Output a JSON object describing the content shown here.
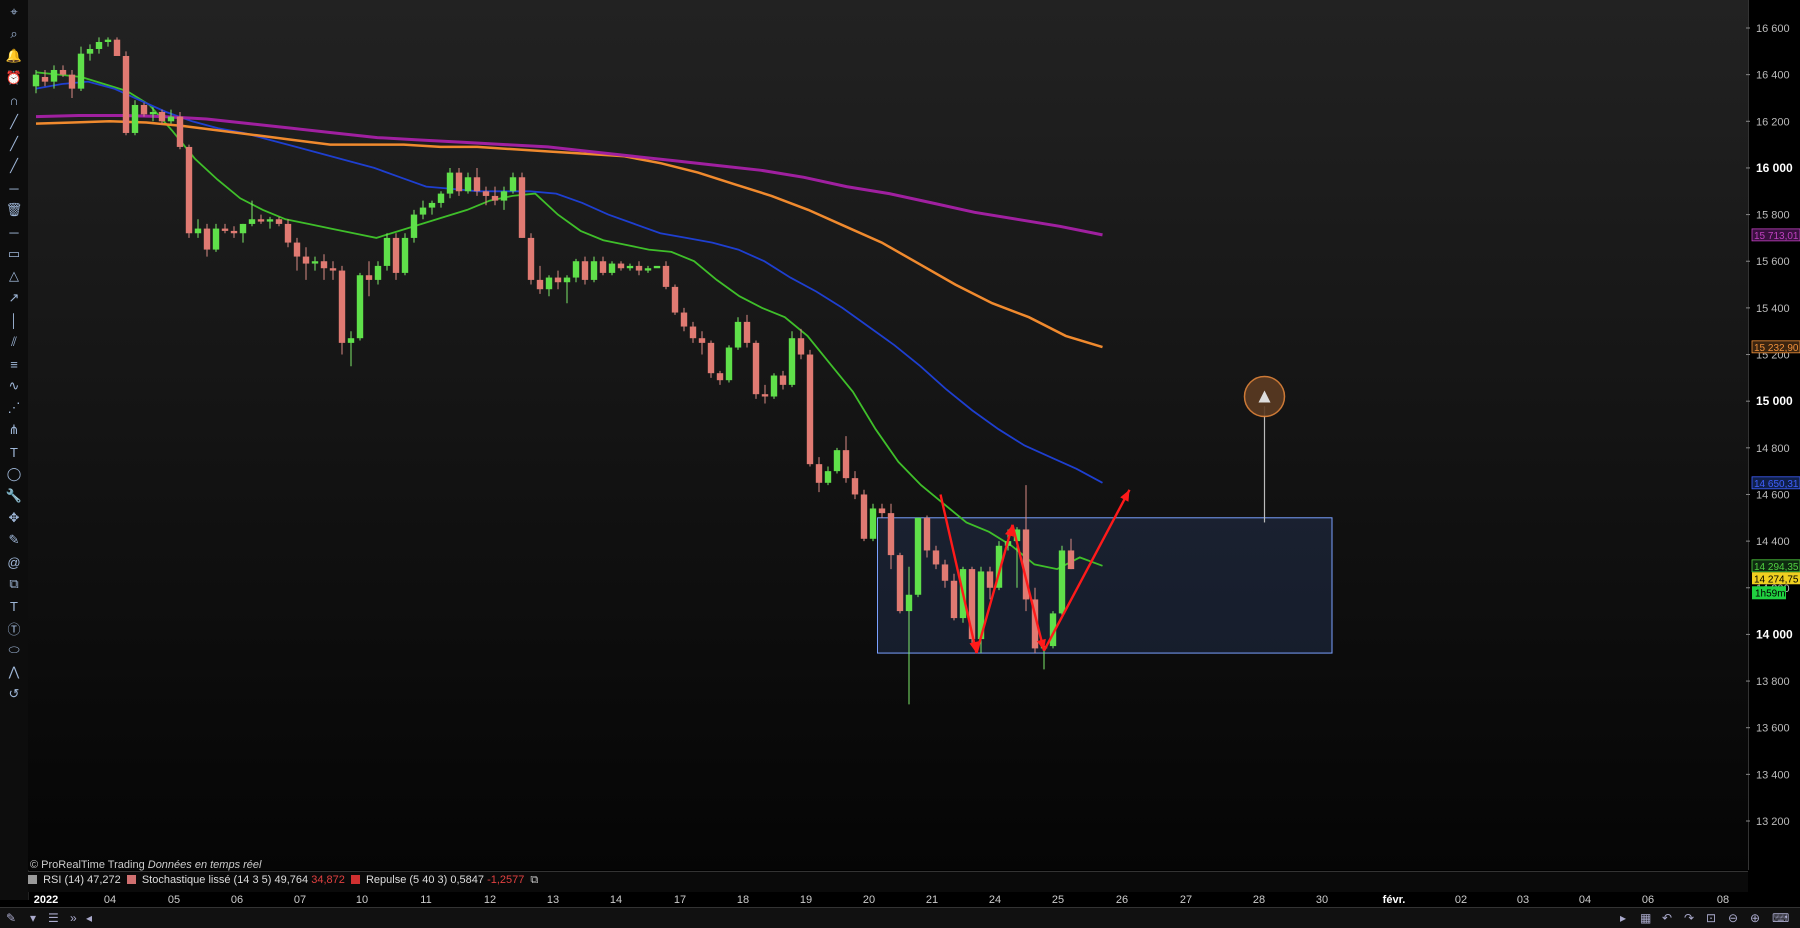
{
  "copyright": {
    "brand": "© ProRealTime Trading",
    "realtime": "Données en temps réel"
  },
  "indicators": [
    {
      "name": "RSI (14)",
      "value": "47,272",
      "color": "#9a9a9a"
    },
    {
      "name": "Stochastique lissé (14 3 5)",
      "value": "49,764",
      "value2": "34,872",
      "color": "#d07070"
    },
    {
      "name": "Repulse (5 40 3)",
      "value": "0,5847",
      "value2": "-1,2577",
      "color": "#d03030"
    }
  ],
  "price_tags": {
    "ma_purple": "15 713,01",
    "ma_orange": "15 232,90",
    "ma_blue": "14 650,31",
    "ma_green": "14 294,35",
    "last": "14 274,75",
    "countdown": "1h59m"
  },
  "chart_data": {
    "type": "candlestick",
    "ylim": [
      13000,
      16700
    ],
    "y_ticks": [
      "16 600",
      "16 400",
      "16 200",
      "16 000",
      "15 800",
      "15 600",
      "15 400",
      "15 200",
      "15 000",
      "14 800",
      "14 600",
      "14 400",
      "14 200",
      "14 000",
      "13 800",
      "13 600",
      "13 400",
      "13 200"
    ],
    "x_labels": [
      "2022",
      "04",
      "05",
      "06",
      "07",
      "10",
      "11",
      "12",
      "13",
      "14",
      "17",
      "18",
      "19",
      "20",
      "21",
      "24",
      "25",
      "26",
      "27",
      "28",
      "30",
      "févr.",
      "02",
      "03",
      "04",
      "06",
      "08"
    ],
    "candles": [
      [
        16350,
        16420,
        16320,
        16400
      ],
      [
        16390,
        16420,
        16350,
        16370
      ],
      [
        16370,
        16440,
        16340,
        16420
      ],
      [
        16420,
        16440,
        16390,
        16400
      ],
      [
        16400,
        16420,
        16300,
        16340
      ],
      [
        16340,
        16520,
        16330,
        16490
      ],
      [
        16490,
        16530,
        16460,
        16510
      ],
      [
        16510,
        16560,
        16490,
        16540
      ],
      [
        16540,
        16560,
        16520,
        16550
      ],
      [
        16550,
        16560,
        16490,
        16480
      ],
      [
        16480,
        16500,
        16140,
        16150
      ],
      [
        16150,
        16290,
        16140,
        16270
      ],
      [
        16270,
        16280,
        16220,
        16230
      ],
      [
        16230,
        16260,
        16200,
        16240
      ],
      [
        16240,
        16250,
        16190,
        16200
      ],
      [
        16200,
        16250,
        16190,
        16220
      ],
      [
        16220,
        16240,
        16080,
        16090
      ],
      [
        16090,
        16100,
        15700,
        15720
      ],
      [
        15720,
        15780,
        15700,
        15740
      ],
      [
        15740,
        15760,
        15620,
        15650
      ],
      [
        15650,
        15760,
        15640,
        15740
      ],
      [
        15740,
        15760,
        15720,
        15730
      ],
      [
        15730,
        15750,
        15700,
        15720
      ],
      [
        15720,
        15760,
        15680,
        15760
      ],
      [
        15760,
        15860,
        15750,
        15780
      ],
      [
        15780,
        15800,
        15760,
        15770
      ],
      [
        15770,
        15790,
        15740,
        15780
      ],
      [
        15780,
        15790,
        15750,
        15760
      ],
      [
        15760,
        15780,
        15660,
        15680
      ],
      [
        15680,
        15700,
        15560,
        15620
      ],
      [
        15620,
        15660,
        15520,
        15590
      ],
      [
        15590,
        15620,
        15560,
        15600
      ],
      [
        15600,
        15630,
        15520,
        15570
      ],
      [
        15570,
        15600,
        15520,
        15560
      ],
      [
        15560,
        15580,
        15200,
        15250
      ],
      [
        15250,
        15300,
        15150,
        15270
      ],
      [
        15270,
        15550,
        15260,
        15540
      ],
      [
        15540,
        15600,
        15450,
        15520
      ],
      [
        15520,
        15600,
        15500,
        15580
      ],
      [
        15580,
        15720,
        15560,
        15700
      ],
      [
        15700,
        15720,
        15520,
        15550
      ],
      [
        15550,
        15720,
        15540,
        15700
      ],
      [
        15700,
        15820,
        15680,
        15800
      ],
      [
        15800,
        15860,
        15780,
        15830
      ],
      [
        15830,
        15860,
        15800,
        15850
      ],
      [
        15850,
        15900,
        15830,
        15890
      ],
      [
        15890,
        16000,
        15870,
        15980
      ],
      [
        15980,
        16000,
        15880,
        15900
      ],
      [
        15900,
        15980,
        15890,
        15960
      ],
      [
        15960,
        16000,
        15880,
        15900
      ],
      [
        15900,
        15920,
        15840,
        15880
      ],
      [
        15880,
        15920,
        15840,
        15860
      ],
      [
        15860,
        15920,
        15820,
        15900
      ],
      [
        15900,
        15980,
        15890,
        15960
      ],
      [
        15960,
        15980,
        15700,
        15700
      ],
      [
        15700,
        15720,
        15500,
        15520
      ],
      [
        15520,
        15580,
        15460,
        15480
      ],
      [
        15480,
        15540,
        15450,
        15530
      ],
      [
        15530,
        15560,
        15480,
        15510
      ],
      [
        15510,
        15540,
        15420,
        15530
      ],
      [
        15530,
        15610,
        15510,
        15600
      ],
      [
        15600,
        15620,
        15500,
        15520
      ],
      [
        15520,
        15620,
        15510,
        15600
      ],
      [
        15600,
        15620,
        15540,
        15550
      ],
      [
        15550,
        15600,
        15540,
        15590
      ],
      [
        15590,
        15600,
        15560,
        15570
      ],
      [
        15570,
        15590,
        15560,
        15580
      ],
      [
        15580,
        15600,
        15540,
        15560
      ],
      [
        15560,
        15580,
        15550,
        15570
      ],
      [
        15570,
        15580,
        15580,
        15580
      ],
      [
        15580,
        15600,
        15480,
        15490
      ],
      [
        15490,
        15500,
        15370,
        15380
      ],
      [
        15380,
        15400,
        15300,
        15320
      ],
      [
        15320,
        15340,
        15250,
        15270
      ],
      [
        15270,
        15300,
        15200,
        15250
      ],
      [
        15250,
        15260,
        15100,
        15120
      ],
      [
        15120,
        15130,
        15070,
        15090
      ],
      [
        15090,
        15240,
        15080,
        15230
      ],
      [
        15230,
        15360,
        15220,
        15340
      ],
      [
        15340,
        15370,
        15230,
        15250
      ],
      [
        15250,
        15260,
        15010,
        15030
      ],
      [
        15030,
        15070,
        14990,
        15020
      ],
      [
        15020,
        15120,
        15010,
        15110
      ],
      [
        15110,
        15130,
        15050,
        15070
      ],
      [
        15070,
        15300,
        15060,
        15270
      ],
      [
        15270,
        15310,
        15180,
        15200
      ],
      [
        15200,
        15220,
        14720,
        14730
      ],
      [
        14730,
        14760,
        14610,
        14650
      ],
      [
        14650,
        14720,
        14640,
        14700
      ],
      [
        14700,
        14800,
        14690,
        14790
      ],
      [
        14790,
        14850,
        14650,
        14670
      ],
      [
        14670,
        14700,
        14580,
        14600
      ],
      [
        14600,
        14620,
        14400,
        14410
      ],
      [
        14410,
        14560,
        14400,
        14540
      ],
      [
        14540,
        14560,
        14500,
        14520
      ],
      [
        14520,
        14560,
        14280,
        14340
      ],
      [
        14340,
        14350,
        14090,
        14100
      ],
      [
        14100,
        14290,
        13700,
        14170
      ],
      [
        14170,
        14500,
        14160,
        14500
      ],
      [
        14500,
        14510,
        14330,
        14360
      ],
      [
        14360,
        14380,
        14280,
        14300
      ],
      [
        14300,
        14320,
        14200,
        14230
      ],
      [
        14230,
        14260,
        14060,
        14070
      ],
      [
        14070,
        14290,
        14050,
        14280
      ],
      [
        14280,
        14290,
        13960,
        13980
      ],
      [
        13980,
        14290,
        13920,
        14270
      ],
      [
        14270,
        14290,
        14150,
        14200
      ],
      [
        14200,
        14400,
        14190,
        14380
      ],
      [
        14380,
        14450,
        14360,
        14400
      ],
      [
        14400,
        14460,
        14200,
        14450
      ],
      [
        14450,
        14640,
        14100,
        14150
      ],
      [
        14150,
        14200,
        13920,
        13940
      ],
      [
        13940,
        13960,
        13850,
        13950
      ],
      [
        13950,
        14100,
        13940,
        14090
      ],
      [
        14090,
        14380,
        14080,
        14360
      ],
      [
        14360,
        14410,
        14280,
        14280
      ]
    ],
    "moving_averages": [
      {
        "name": "MA20",
        "color": "#3fbf2a",
        "values": [
          16410,
          16400,
          16390,
          16360,
          16330,
          16270,
          16160,
          16040,
          15950,
          15870,
          15820,
          15780,
          15760,
          15740,
          15720,
          15700,
          15730,
          15760,
          15790,
          15820,
          15860,
          15880,
          15890,
          15800,
          15730,
          15690,
          15670,
          15650,
          15640,
          15600,
          15520,
          15450,
          15400,
          15360,
          15280,
          15160,
          15040,
          14880,
          14740,
          14640,
          14560,
          14480,
          14440,
          14380,
          14300,
          14280,
          14330,
          14294
        ]
      },
      {
        "name": "MA50",
        "color": "#1e3fd0",
        "values": [
          16340,
          16360,
          16370,
          16340,
          16290,
          16240,
          16200,
          16170,
          16150,
          16120,
          16090,
          16060,
          16030,
          16000,
          15960,
          15920,
          15910,
          15900,
          15900,
          15900,
          15890,
          15850,
          15800,
          15760,
          15720,
          15700,
          15680,
          15650,
          15600,
          15530,
          15470,
          15400,
          15320,
          15240,
          15150,
          15050,
          14960,
          14880,
          14810,
          14760,
          14710,
          14650
        ]
      },
      {
        "name": "MA100",
        "color": "#f08a2e",
        "values": [
          16190,
          16195,
          16200,
          16195,
          16180,
          16160,
          16140,
          16120,
          16100,
          16100,
          16100,
          16090,
          16090,
          16080,
          16070,
          16060,
          16050,
          16020,
          15980,
          15930,
          15880,
          15820,
          15750,
          15680,
          15590,
          15500,
          15420,
          15360,
          15280,
          15232
        ]
      },
      {
        "name": "MA200",
        "color": "#a020a0",
        "values": [
          16220,
          16225,
          16225,
          16220,
          16210,
          16190,
          16170,
          16150,
          16130,
          16120,
          16110,
          16100,
          16090,
          16070,
          16050,
          16030,
          16010,
          15990,
          15960,
          15920,
          15890,
          15850,
          15810,
          15780,
          15750,
          15713
        ]
      }
    ],
    "annotations": {
      "box": {
        "x0": 93.5,
        "x1": 144,
        "y0": 13920,
        "y1": 14500
      },
      "arrows": [
        [
          [
            100.5,
            14600
          ],
          [
            104.5,
            13920
          ]
        ],
        [
          [
            104.5,
            13920
          ],
          [
            108.5,
            14470
          ]
        ],
        [
          [
            108.5,
            14470
          ],
          [
            112,
            13930
          ]
        ],
        [
          [
            112,
            13930
          ],
          [
            121.5,
            14620
          ]
        ]
      ],
      "target_line": {
        "x": 136.5,
        "y0": 14480,
        "y1": 15030
      },
      "target_circle": {
        "x": 136.5,
        "y": 15020
      }
    }
  }
}
